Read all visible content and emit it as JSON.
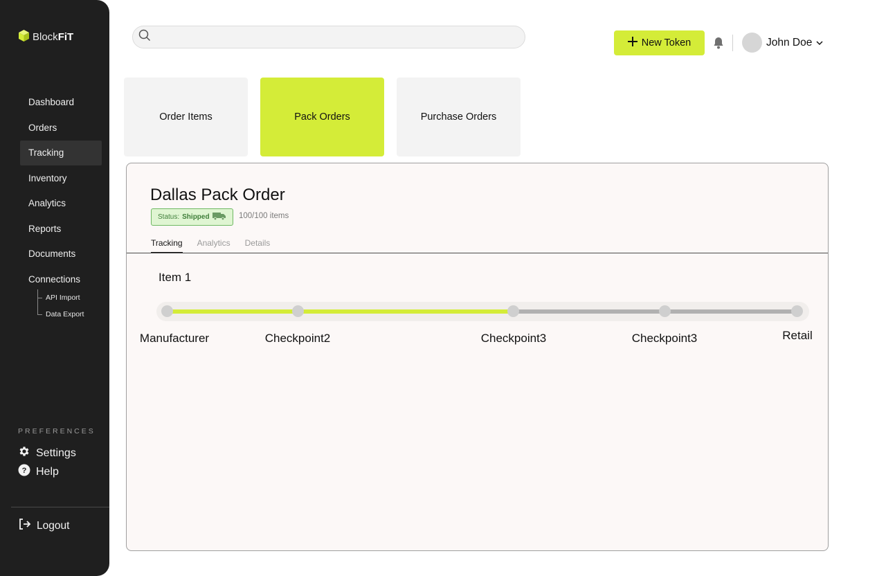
{
  "app": {
    "brand_part1": "Block",
    "brand_part2": "FiT"
  },
  "sidebar": {
    "nav": [
      {
        "label": "Dashboard"
      },
      {
        "label": "Orders"
      },
      {
        "label": "Tracking",
        "active": true
      },
      {
        "label": "Inventory"
      },
      {
        "label": "Analytics"
      },
      {
        "label": "Reports"
      },
      {
        "label": "Documents"
      },
      {
        "label": "Connections"
      }
    ],
    "subnav": [
      {
        "label": "API Import"
      },
      {
        "label": "Data Export"
      }
    ],
    "preferences_label": "PREFERENCES",
    "settings_label": "Settings",
    "help_label": "Help",
    "logout_label": "Logout"
  },
  "header": {
    "search_placeholder": "",
    "new_token_label": "New Token",
    "user_name": "John Doe"
  },
  "order_tabs": [
    {
      "label": "Order Items"
    },
    {
      "label": "Pack Orders",
      "active": true
    },
    {
      "label": "Purchase Orders"
    }
  ],
  "order": {
    "title": "Dallas Pack Order",
    "status_prefix": "Status:",
    "status_value": "Shipped",
    "items_count": "100/100 items",
    "tabs": [
      {
        "label": "Tracking",
        "active": true
      },
      {
        "label": "Analytics"
      },
      {
        "label": "Details"
      }
    ],
    "item_title": "Item 1",
    "checkpoints": [
      {
        "label": "Manufacturer",
        "reached": true
      },
      {
        "label": "Checkpoint2",
        "reached": true
      },
      {
        "label": "Checkpoint3",
        "reached": true
      },
      {
        "label": "Checkpoint3",
        "reached": false
      },
      {
        "label": "Retail",
        "reached": false
      }
    ]
  },
  "colors": {
    "accent": "#d4ec38",
    "sidebar_bg": "#1f1f1f",
    "status_green": "#3f7e3a",
    "pending_gray": "#b1b1b1"
  }
}
